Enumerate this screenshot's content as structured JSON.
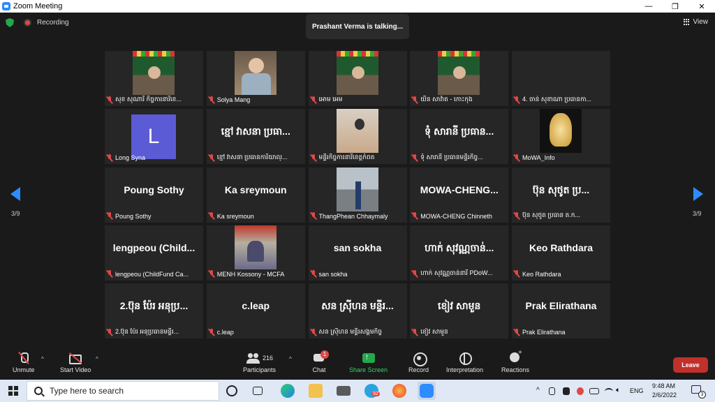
{
  "window": {
    "title": "Zoom Meeting",
    "controls": [
      "—",
      "❐",
      "✕"
    ]
  },
  "meeting": {
    "recording_label": "Recording",
    "talking_banner": "Prashant Verma is talking...",
    "view_label": "View",
    "page_indicator_left": "3/9",
    "page_indicator_right": "3/9"
  },
  "tiles": [
    {
      "name": "សុខ សុណារី កិច្ចការនារីខេ...",
      "big": "",
      "video": "vid-green"
    },
    {
      "name": "Solya Mang",
      "big": "",
      "video": "vid-room"
    },
    {
      "name": "អោម អេម",
      "big": "",
      "video": "vid-green"
    },
    {
      "name": "យិន សាវ៉ាត - កោះកុង",
      "big": "",
      "video": "vid-green"
    },
    {
      "name": "4. ចាន់ សុខាណា ប្រធានកា...",
      "big": "",
      "video": ""
    },
    {
      "name": "Long Syna",
      "big": "",
      "video": "avatar",
      "avatar_letter": "L"
    },
    {
      "name": "ខ្មៅ វាសនា ប្រធានការិយាល្...",
      "big": "ខ្មៅ វាសនា ប្រធា...",
      "video": ""
    },
    {
      "name": "មន្ទីរកិច្ចការនារីខេត្តកំពត",
      "big": "",
      "video": "vid-office"
    },
    {
      "name": "ទុំ សារានី ប្រធានមន្ទីរកិច្ច...",
      "big": "ទុំ សារានី ប្រធាន...",
      "video": ""
    },
    {
      "name": "MoWA_Info",
      "big": "",
      "video": "vid-mowa"
    },
    {
      "name": "Poung Sothy",
      "big": "Poung Sothy",
      "video": ""
    },
    {
      "name": "Ka sreymoun",
      "big": "Ka sreymoun",
      "video": ""
    },
    {
      "name": "ThangPhean Chhaymaly",
      "big": "",
      "video": "vid-road"
    },
    {
      "name": "MOWA-CHENG Chinneth",
      "big": "MOWA-CHENG...",
      "video": ""
    },
    {
      "name": "ប៊ុន សុថូត ប្រធាន ត.ក...",
      "big": "ប៊ុន សុថូត ប្រ...",
      "video": ""
    },
    {
      "name": "lengpeou (ChildFund Ca...",
      "big": "lengpeou (Child...",
      "video": ""
    },
    {
      "name": "MENH Kossony - MCFA",
      "big": "",
      "video": "vid-event"
    },
    {
      "name": "san sokha",
      "big": "san sokha",
      "video": ""
    },
    {
      "name": "ហាក់ សុវណ្ណចាន់នារី PDoW...",
      "big": "ហាក់ សុវណ្ណចាន់...",
      "video": ""
    },
    {
      "name": "Keo Rathdara",
      "big": "Keo Rathdara",
      "video": ""
    },
    {
      "name": "2.ប៊ុន ប៉ែរ អនុប្រធានមន្ទីរ...",
      "big": "2.ប៊ុន ប៉ែរ អនុប្រ...",
      "video": ""
    },
    {
      "name": "c.leap",
      "big": "c.leap",
      "video": ""
    },
    {
      "name": "សន ស្រ៊ីហន មន្ទីរសង្គមកិច្ច",
      "big": "សន ស្រ៊ីហន មន្ទីរ...",
      "video": ""
    },
    {
      "name": "ខៀវ សាមួន",
      "big": "ខៀវ សាមួន",
      "video": ""
    },
    {
      "name": "Prak Elirathana",
      "big": "Prak Elirathana",
      "video": ""
    }
  ],
  "toolbar": {
    "unmute": "Unmute",
    "start_video": "Start Video",
    "participants": "Participants",
    "participants_count": "216",
    "chat": "Chat",
    "chat_badge": "1",
    "share_screen": "Share Screen",
    "record": "Record",
    "interpretation": "Interpretation",
    "reactions": "Reactions",
    "leave": "Leave",
    "colors": {
      "leave": "#c1302a",
      "share": "#23a84c",
      "accent": "#2d8cff"
    }
  },
  "taskbar": {
    "search_placeholder": "Type here to search",
    "telegram_badge": "92",
    "language": "ENG",
    "time": "9:48 AM",
    "date": "2/6/2022",
    "notification_count": "3"
  }
}
